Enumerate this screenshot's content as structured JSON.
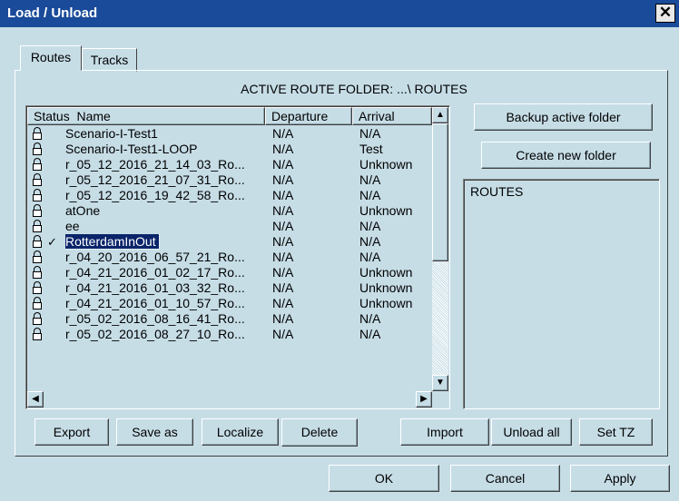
{
  "window": {
    "title": "Load / Unload",
    "close_glyph": "✕"
  },
  "tabs": [
    {
      "label": "Routes"
    },
    {
      "label": "Tracks"
    }
  ],
  "active_folder": {
    "text": "ACTIVE ROUTE FOLDER:  ...\\ ROUTES"
  },
  "routes_table": {
    "columns": {
      "status": "Status",
      "name": "Name",
      "departure": "Departure",
      "arrival": "Arrival"
    },
    "rows": [
      {
        "name": "Scenario-I-Test1",
        "departure": "N/A",
        "arrival": "N/A",
        "checked": ""
      },
      {
        "name": "Scenario-I-Test1-LOOP",
        "departure": "N/A",
        "arrival": "Test",
        "checked": ""
      },
      {
        "name": "r_05_12_2016_21_14_03_Ro...",
        "departure": "N/A",
        "arrival": "Unknown",
        "checked": ""
      },
      {
        "name": "r_05_12_2016_21_07_31_Ro...",
        "departure": "N/A",
        "arrival": "N/A",
        "checked": ""
      },
      {
        "name": "r_05_12_2016_19_42_58_Ro...",
        "departure": "N/A",
        "arrival": "N/A",
        "checked": ""
      },
      {
        "name": "atOne",
        "departure": "N/A",
        "arrival": "Unknown",
        "checked": ""
      },
      {
        "name": "ee",
        "departure": "N/A",
        "arrival": "N/A",
        "checked": ""
      },
      {
        "name": "RotterdamInOut",
        "departure": "N/A",
        "arrival": "N/A",
        "checked": "✓"
      },
      {
        "name": "r_04_20_2016_06_57_21_Ro...",
        "departure": "N/A",
        "arrival": "N/A",
        "checked": ""
      },
      {
        "name": "r_04_21_2016_01_02_17_Ro...",
        "departure": "N/A",
        "arrival": "Unknown",
        "checked": ""
      },
      {
        "name": "r_04_21_2016_01_03_32_Ro...",
        "departure": "N/A",
        "arrival": "Unknown",
        "checked": ""
      },
      {
        "name": "r_04_21_2016_01_10_57_Ro...",
        "departure": "N/A",
        "arrival": "Unknown",
        "checked": ""
      },
      {
        "name": "r_05_02_2016_08_16_41_Ro...",
        "departure": "N/A",
        "arrival": "N/A",
        "checked": ""
      },
      {
        "name": "r_05_02_2016_08_27_10_Ro...",
        "departure": "N/A",
        "arrival": "N/A",
        "checked": ""
      }
    ],
    "selected_index": 7,
    "icons": {
      "status": "lock-icon",
      "check": "checkmark-icon"
    }
  },
  "scrollbars": {
    "up": "▲",
    "down": "▼",
    "left": "◀",
    "right": "▶",
    "vertical_position": 0.0,
    "vertical_visible_fraction": 0.55
  },
  "side_buttons": {
    "backup": "Backup active folder",
    "create": "Create new folder"
  },
  "folder_list": {
    "items": [
      "ROUTES"
    ]
  },
  "action_buttons": {
    "export": "Export",
    "save_as": "Save as",
    "localize": "Localize",
    "delete": "Delete",
    "import": "Import",
    "unload_all": "Unload all",
    "set_tz": "Set TZ"
  },
  "dialog_buttons": {
    "ok": "OK",
    "cancel": "Cancel",
    "apply": "Apply"
  },
  "colors": {
    "background": "#c6dde6",
    "titlebar": "#1a4b9a",
    "selection": "#0a246a"
  }
}
